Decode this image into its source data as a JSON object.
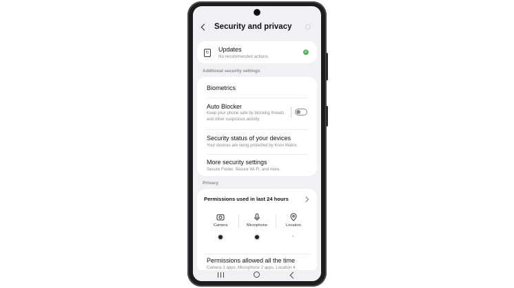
{
  "header": {
    "title": "Security and privacy",
    "back_icon": "chevron-left-icon",
    "search_icon": "search-icon"
  },
  "updates": {
    "title": "Updates",
    "subtitle": "No recommended actions",
    "icon": "update-icon",
    "status_color": "#5ab55e"
  },
  "additional": {
    "section_label": "Addtional security settings",
    "items": [
      {
        "title": "Biometrics",
        "subtitle": ""
      },
      {
        "title": "Auto Blocker",
        "subtitle": "Keep your phone safe by blocking threats and other suspicious activity.",
        "toggle": "off"
      },
      {
        "title": "Security status of your devices",
        "subtitle": "Your devices are veing protected by Knox Matrix."
      },
      {
        "title": "More security settings",
        "subtitle": "Secure Folder, Secure Wi-Fi, and more."
      }
    ]
  },
  "privacy": {
    "section_label": "Privacy",
    "permissions_title": "Permissions used in last 24 hours",
    "columns": [
      {
        "label": "Camera",
        "icon": "camera-icon",
        "status": "used"
      },
      {
        "label": "Microphone",
        "icon": "microphone-icon",
        "status": "used"
      },
      {
        "label": "Location",
        "icon": "location-icon",
        "status": "-"
      }
    ],
    "allowed_title": "Permissions allowed all the time",
    "allowed_subtitle": "Camera 3 apps, Microphone 2 apps, Location 4"
  },
  "navbar": {
    "recents_icon": "recents-icon",
    "home_icon": "home-icon",
    "back_icon": "back-icon"
  }
}
